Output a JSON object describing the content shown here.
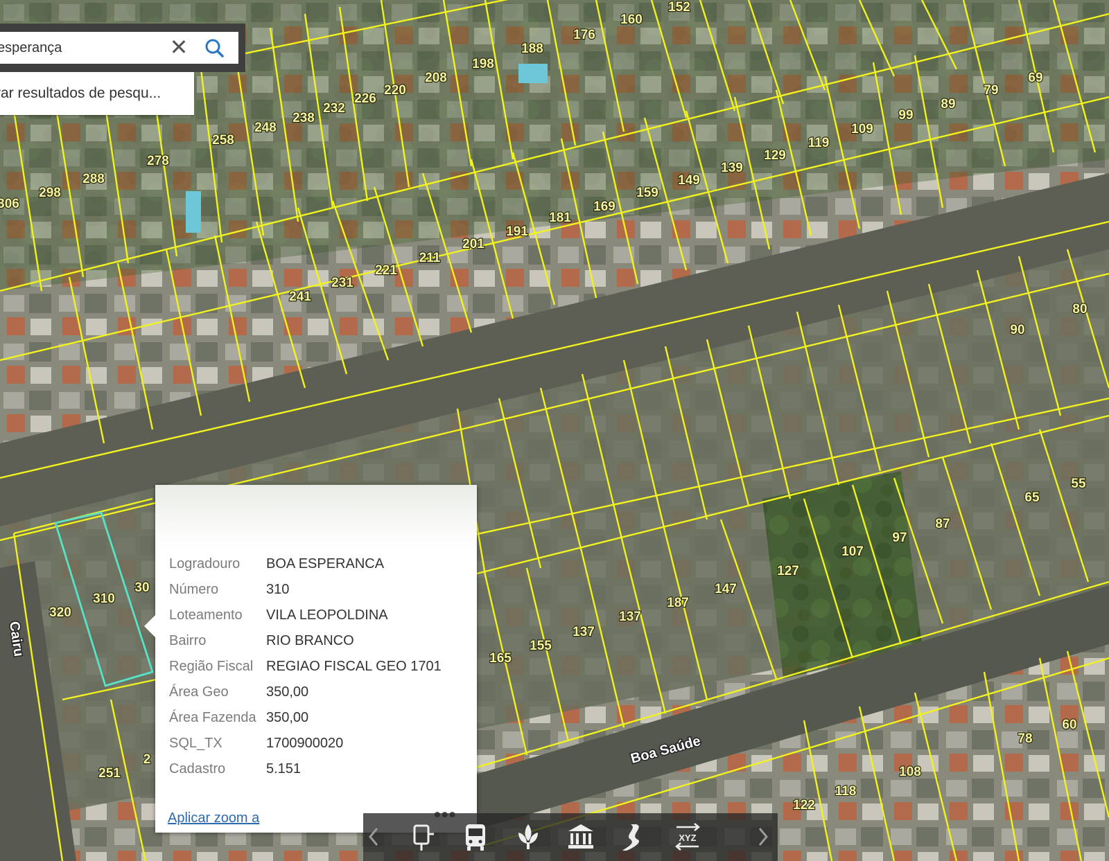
{
  "search": {
    "value": "esperança",
    "suggestion": "rar resultados de pesqu..."
  },
  "map": {
    "colors": {
      "lot_line": "#f2f21e",
      "selected_lot": "#56e3c6",
      "road": "#5d5f55"
    },
    "street_labels": [
      "Boa Saúde",
      "Cairu"
    ],
    "lot_numbers": [
      "152",
      "160",
      "176",
      "188",
      "198",
      "208",
      "220",
      "226",
      "232",
      "238",
      "248",
      "258",
      "278",
      "288",
      "298",
      "306",
      "69",
      "79",
      "89",
      "99",
      "109",
      "119",
      "129",
      "139",
      "149",
      "159",
      "169",
      "181",
      "191",
      "201",
      "211",
      "221",
      "231",
      "241",
      "90",
      "80",
      "55",
      "65",
      "87",
      "97",
      "107",
      "127",
      "147",
      "187",
      "137",
      "137",
      "155",
      "165",
      "310",
      "30",
      "320",
      "251",
      "78",
      "60",
      "108",
      "118",
      "122",
      "2"
    ]
  },
  "popup": {
    "attributes": [
      {
        "label": "Logradouro",
        "value": "BOA ESPERANCA"
      },
      {
        "label": "Número",
        "value": "310"
      },
      {
        "label": "Loteamento",
        "value": "VILA LEOPOLDINA"
      },
      {
        "label": "Bairro",
        "value": "RIO BRANCO"
      },
      {
        "label": "Região Fiscal",
        "value": "REGIAO FISCAL GEO 1701"
      },
      {
        "label": "Área Geo",
        "value": "350,00"
      },
      {
        "label": "Área Fazenda",
        "value": "350,00"
      },
      {
        "label": "SQL_TX",
        "value": "1700900020"
      },
      {
        "label": "Cadastro",
        "value": "5.151"
      }
    ],
    "zoom_link": "Aplicar zoom a",
    "more_label": "•••"
  },
  "toolbar": {
    "icons": [
      "bus-stop-icon",
      "bus-icon",
      "tree-icon",
      "building-icon",
      "road-icon",
      "xyz-icon"
    ],
    "xyz_label": "XYZ"
  }
}
